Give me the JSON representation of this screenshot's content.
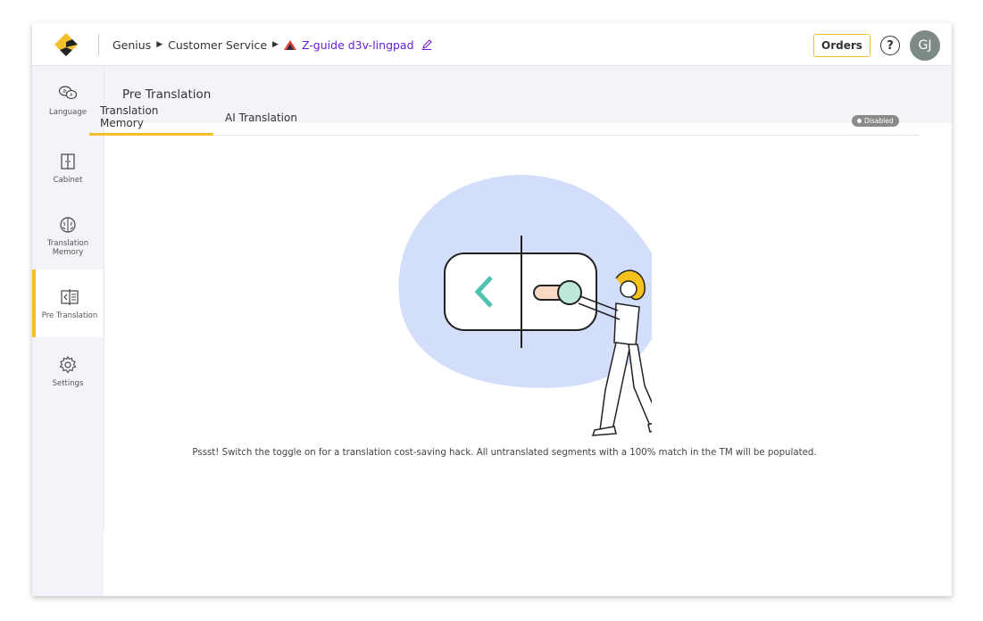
{
  "topbar": {
    "breadcrumb": [
      "Genius",
      "Customer Service"
    ],
    "project_name": "Z-guide d3v-lingpad",
    "orders_label": "Orders",
    "help_label": "?",
    "avatar_initials": "GJ"
  },
  "sidebar": {
    "items": [
      {
        "label": "Language",
        "icon": "language-icon"
      },
      {
        "label": "Cabinet",
        "icon": "cabinet-icon"
      },
      {
        "label": "Translation Memory",
        "icon": "brain-icon"
      },
      {
        "label": "Pre Translation",
        "icon": "pre-translation-icon",
        "active": true
      },
      {
        "label": "Settings",
        "icon": "gear-icon"
      }
    ]
  },
  "page": {
    "title": "Pre Translation",
    "tabs": [
      {
        "label": "Translation Memory",
        "active": true
      },
      {
        "label": "AI Translation",
        "active": false
      }
    ],
    "status": "Disabled",
    "hint": "Pssst! Switch the toggle on for a translation cost-saving hack. All untranslated segments with a 100% match in the TM will be populated."
  },
  "colors": {
    "accent": "#f4bf2a",
    "project": "#6a1ed8",
    "sidebar_bg": "#f3f4f9",
    "illustration_blob": "#d2defa",
    "illustration_teal": "#4fc3b0"
  }
}
